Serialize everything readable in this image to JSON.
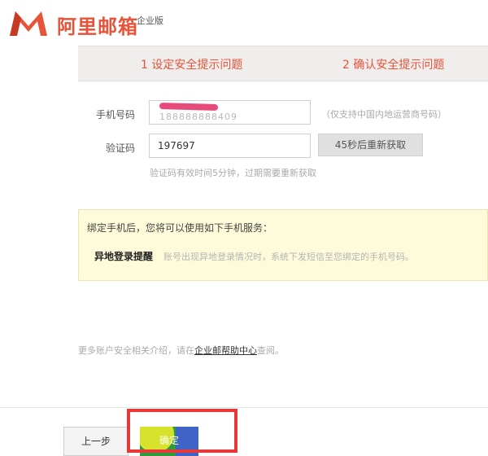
{
  "header": {
    "brand_title": "阿里邮箱",
    "brand_subtitle": "企业版",
    "logo_icon": "mail-m-logo-icon"
  },
  "steps": [
    "1 设定安全提示问题",
    "2 确认安全提示问题"
  ],
  "form": {
    "phone_label": "手机号码",
    "phone_value_partial": "188888888409",
    "phone_hint": "（仅支持中国内地运营商号码）",
    "code_label": "验证码",
    "code_value": "197697",
    "resend_label": "45秒后重新获取",
    "code_note": "验证码有效时间5分钟，过期需要重新获取"
  },
  "info": {
    "title": "绑定手机后，您将可以使用如下手机服务：",
    "service_name": "异地登录提醒",
    "service_desc": "账号出现异地登录情况时，系统下发短信至您绑定的手机号码。"
  },
  "footer": {
    "more_prefix": "更多账户安全相关介绍，请在",
    "more_link": "企业邮帮助中心",
    "more_suffix": "查阅。",
    "prev_label": "上一步",
    "ok_label": "确定"
  },
  "colors": {
    "accent": "#e8543a",
    "redaction": "#e74b7c",
    "highlight": "#e83838"
  }
}
